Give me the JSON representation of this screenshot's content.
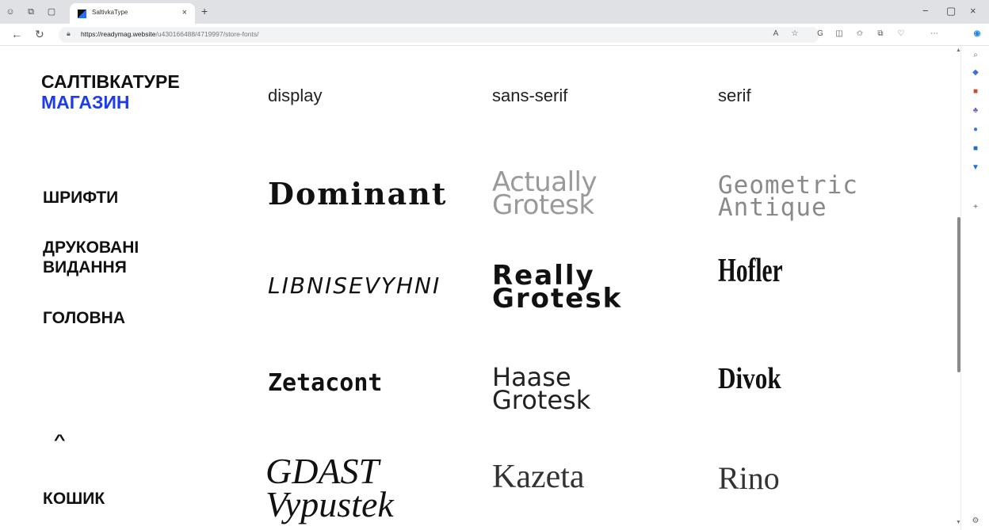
{
  "browser": {
    "tab_title": "SaltivkaType",
    "tab_close": "×",
    "new_tab": "+",
    "url_host": "https://readymag.website",
    "url_path": "/u430166488/4719997/store-fonts/",
    "window_controls": [
      "−",
      "▢",
      "×"
    ],
    "icons": {
      "profile": "profile-icon",
      "workspaces": "workspaces-icon",
      "tab_actions": "tab-actions-icon",
      "back": "back-icon",
      "refresh": "refresh-icon",
      "lock": "lock-icon",
      "read_aloud": "read-aloud-icon",
      "favorite": "star-icon",
      "extensions": "extensions-icon",
      "split": "split-screen-icon",
      "favorites_bar": "favorites-icon",
      "collections": "collections-icon",
      "performance": "heart-icon",
      "more": "more-icon",
      "copilot": "copilot-icon"
    }
  },
  "sidebar_edge": {
    "icons": [
      "search-icon",
      "tag-icon",
      "briefcase-icon",
      "people-icon",
      "office-icon",
      "outlook-icon",
      "drop-icon",
      "add-icon",
      "settings-icon"
    ]
  },
  "page": {
    "brand_line1": "САЛТІВКАТУРЕ",
    "brand_line2": "МАГАЗИН",
    "brand_colors": {
      "primary": "#111111",
      "accent": "#1c3cf0"
    },
    "categories": [
      "display",
      "sans-serif",
      "serif"
    ],
    "menu": {
      "fonts": "ШРИФТИ",
      "print_line1": "ДРУКОВАНІ",
      "print_line2": "ВИДАННЯ",
      "home": "ГОЛОВНА",
      "cart": "КОШИК"
    },
    "fonts": {
      "dominant": "Dominant",
      "actually_1": "Actually",
      "actually_2": "Grotesk",
      "geometric_1": "Geometric",
      "geometric_2": "Antique",
      "libnis": "LIBNISEVYHNI",
      "really_1": "Really",
      "really_2": "Grotesk",
      "hofler": "Hofler",
      "zetacont": "Zetacont",
      "haase_1": "Haase",
      "haase_2": "Grotesk",
      "divok": "Divok",
      "gdast_1": "GDAST",
      "gdast_2": "Vypustek",
      "kazeta": "Kazeta",
      "rino": "Rino"
    }
  }
}
